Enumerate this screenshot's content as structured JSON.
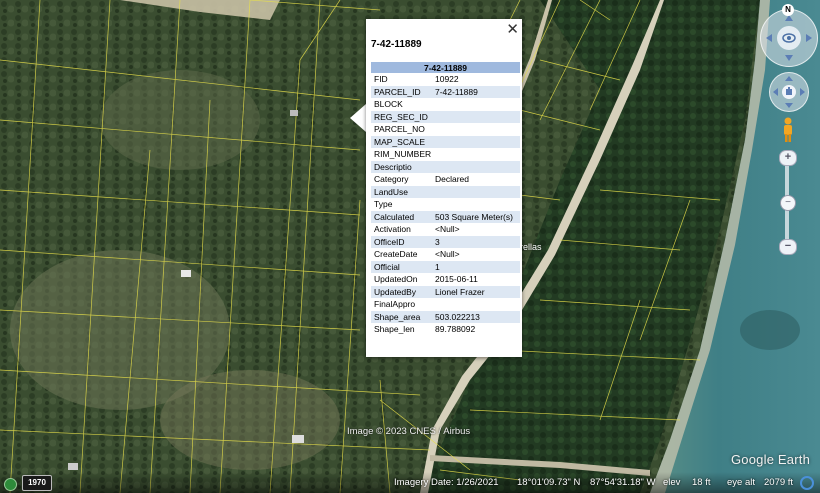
{
  "balloon": {
    "heading": "7-42-11889",
    "table_header": "7-42-11889",
    "rows": [
      {
        "key": "FID",
        "value": "10922"
      },
      {
        "key": "PARCEL_ID",
        "value": "7-42-11889"
      },
      {
        "key": "BLOCK",
        "value": ""
      },
      {
        "key": "REG_SEC_ID",
        "value": ""
      },
      {
        "key": "PARCEL_NO",
        "value": ""
      },
      {
        "key": "MAP_SCALE",
        "value": ""
      },
      {
        "key": "RIM_NUMBER",
        "value": ""
      },
      {
        "key": "Descriptio",
        "value": ""
      },
      {
        "key": "Category",
        "value": "Declared"
      },
      {
        "key": "LandUse",
        "value": ""
      },
      {
        "key": "Type",
        "value": ""
      },
      {
        "key": "Calculated",
        "value": "503 Square Meter(s)"
      },
      {
        "key": "Activation",
        "value": "<Null>"
      },
      {
        "key": "OfficeID",
        "value": "3"
      },
      {
        "key": "CreateDate",
        "value": "<Null>"
      },
      {
        "key": "Official",
        "value": "1"
      },
      {
        "key": "UpdatedOn",
        "value": "2015-06-11"
      },
      {
        "key": "UpdatedBy",
        "value": "Lionel Frazer"
      },
      {
        "key": "FinalAppro",
        "value": ""
      },
      {
        "key": "Shape_area",
        "value": "503.022213"
      },
      {
        "key": "Shape_len",
        "value": "89.788092"
      }
    ],
    "close_glyph": "✕"
  },
  "map": {
    "copyright": "Image © 2023 CNES / Airbus",
    "place_label": "rellas",
    "logo": "Google Earth"
  },
  "navigation": {
    "north_label": "N",
    "zoom_in": "+",
    "zoom_out": "−",
    "zoom_thumb": "−"
  },
  "status_bar": {
    "historical_year": "1970",
    "imagery_date": "Imagery Date: 1/26/2021",
    "latitude": "18°01'09.73\" N",
    "longitude": "87°54'31.18\" W",
    "elev_label": "elev",
    "elev_value": "18 ft",
    "eye_alt_label": "eye alt",
    "eye_alt_value": "2079 ft"
  },
  "colors": {
    "parcel_lines": "#e8e04a",
    "table_header": "#9fb9de",
    "row_alt": "#dde7f3",
    "water": "#3f7f86"
  }
}
